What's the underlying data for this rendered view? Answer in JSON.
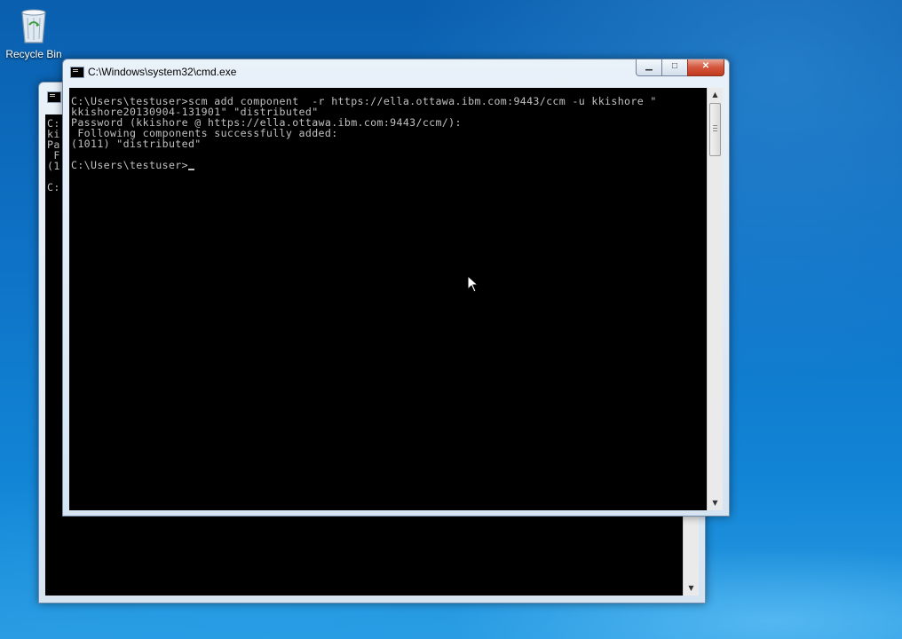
{
  "desktop": {
    "icons": [
      {
        "label": "Recycle Bin",
        "icon": "recycle-bin-icon"
      }
    ]
  },
  "back_window": {
    "title": "",
    "console_lines": [
      "C:",
      "ki",
      "Pa",
      " F",
      "(1",
      "",
      "C:"
    ]
  },
  "front_window": {
    "title": "C:\\Windows\\system32\\cmd.exe",
    "controls": {
      "minimize": "▁",
      "maximize": "□",
      "close": "✕"
    },
    "console_lines": [
      "C:\\Users\\testuser>scm add component  -r https://ella.ottawa.ibm.com:9443/ccm -u kkishore \"",
      "kkishore20130904-131901\" \"distributed\"",
      "Password (kkishore @ https://ella.ottawa.ibm.com:9443/ccm/):",
      " Following components successfully added:",
      "(1011) \"distributed\"",
      "",
      "C:\\Users\\testuser>"
    ]
  },
  "colors": {
    "console_bg": "#000000",
    "console_fg": "#c0c0c0",
    "close_button": "#c8452b"
  }
}
